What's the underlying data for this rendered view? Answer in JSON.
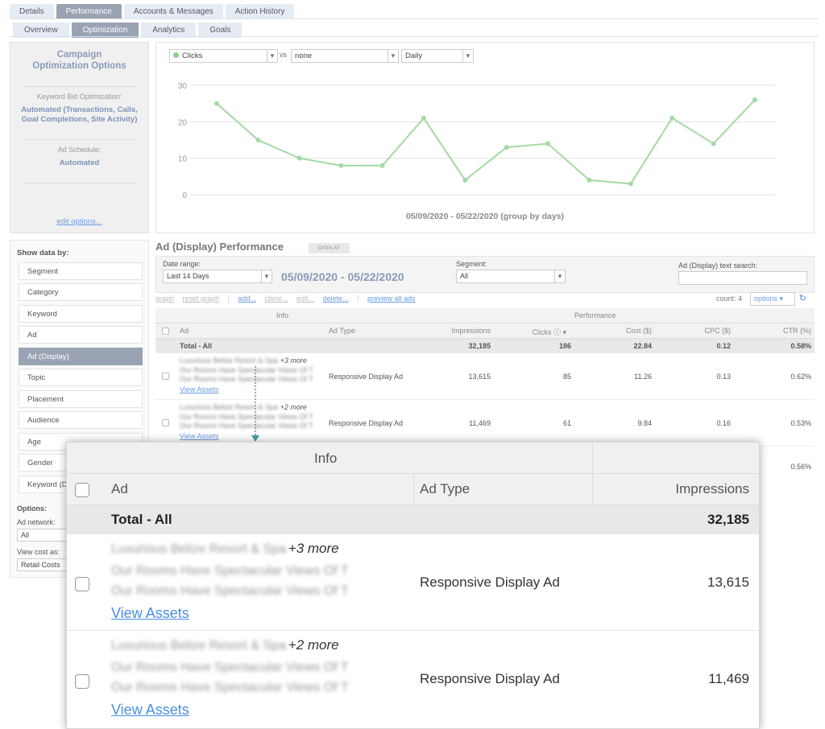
{
  "tabs": [
    "Details",
    "Performance",
    "Accounts & Messages",
    "Action History"
  ],
  "subtabs": [
    "Overview",
    "Optimization",
    "Analytics",
    "Goals"
  ],
  "left_panel": {
    "title": "Campaign Optimization Options",
    "bid_label": "Keyword Bid Optimization:",
    "bid_value": "Automated (Transactions, Calls, Goal Completions, Site Activity)",
    "schedule_label": "Ad Schedule:",
    "schedule_value": "Automated",
    "edit_link": "edit options..."
  },
  "chart_controls": {
    "metric": "Clicks",
    "vs": "vs",
    "compare": "none",
    "interval": "Daily"
  },
  "chart_data": {
    "type": "line",
    "title": "",
    "xlabel": "05/09/2020 - 05/22/2020 (group by days)",
    "ylabel": "",
    "ylim": [
      0,
      30
    ],
    "yticks": [
      "0",
      "10",
      "20",
      "30"
    ],
    "grid": true,
    "series": [
      {
        "name": "Clicks",
        "color": "#a5d9a5",
        "values": [
          25,
          15,
          10,
          8,
          8,
          21,
          4,
          13,
          14,
          4,
          3,
          21,
          14,
          26
        ]
      }
    ]
  },
  "sidebar": {
    "title": "Show data by:",
    "items": [
      "Segment",
      "Category",
      "Keyword",
      "Ad",
      "Ad (Display)",
      "Topic",
      "Placement",
      "Audience",
      "Age",
      "Gender",
      "Keyword (D"
    ],
    "options_title": "Options:",
    "network_label": "Ad network:",
    "network_value": "All",
    "cost_label": "View cost as:",
    "cost_value": "Retail Costs"
  },
  "performance": {
    "title": "Ad (Display) Performance",
    "badge": "DISPLAY",
    "date_range_label": "Date range:",
    "date_range_value": "Last 14 Days",
    "date_display": "05/09/2020 - 05/22/2020",
    "segment_label": "Segment:",
    "segment_value": "All",
    "search_label": "Ad (Display) text search:",
    "toolbar": {
      "graph": "graph",
      "reset_graph": "reset graph",
      "add": "add...",
      "clone": "clone...",
      "edit": "edit...",
      "delete": "delete...",
      "preview": "preview all ads",
      "count": "count: 4",
      "options": "options"
    },
    "group_info": "Info",
    "group_perf": "Performance",
    "columns": [
      "Ad",
      "Ad Type",
      "Impressions",
      "Clicks",
      "Cost ($)",
      "CPC ($)",
      "CTR (%)"
    ],
    "total": {
      "label": "Total - All",
      "impressions": "32,185",
      "clicks": "186",
      "cost": "22.84",
      "cpc": "0.12",
      "ctr": "0.58%"
    },
    "rows": [
      {
        "name": "Luxurious Belize Resort & Spa",
        "more": "+3 more",
        "line2": "Our Rooms Have Spectacular Views Of T",
        "line3": "Our Rooms Have Spectacular Views Of T",
        "link": "View Assets",
        "type": "Responsive Display Ad",
        "impressions": "13,615",
        "clicks": "85",
        "cost": "11.26",
        "cpc": "0.13",
        "ctr": "0.62%"
      },
      {
        "name": "Luxurious Belize Resort & Spa",
        "more": "+2 more",
        "line2": "Our Rooms Have Spectacular Views Of T",
        "line3": "Our Rooms Have Spectacular Views Of T",
        "link": "View Assets",
        "type": "Responsive Display Ad",
        "impressions": "11,469",
        "clicks": "61",
        "cost": "9.84",
        "cpc": "0.16",
        "ctr": "0.53%"
      }
    ],
    "hidden_row_ctr": "0.56%"
  },
  "colors": {
    "accent_tab": "#9aa3b4",
    "link": "#6a9be0",
    "line": "#a5d9a5",
    "date_text": "#8a9ab8"
  }
}
